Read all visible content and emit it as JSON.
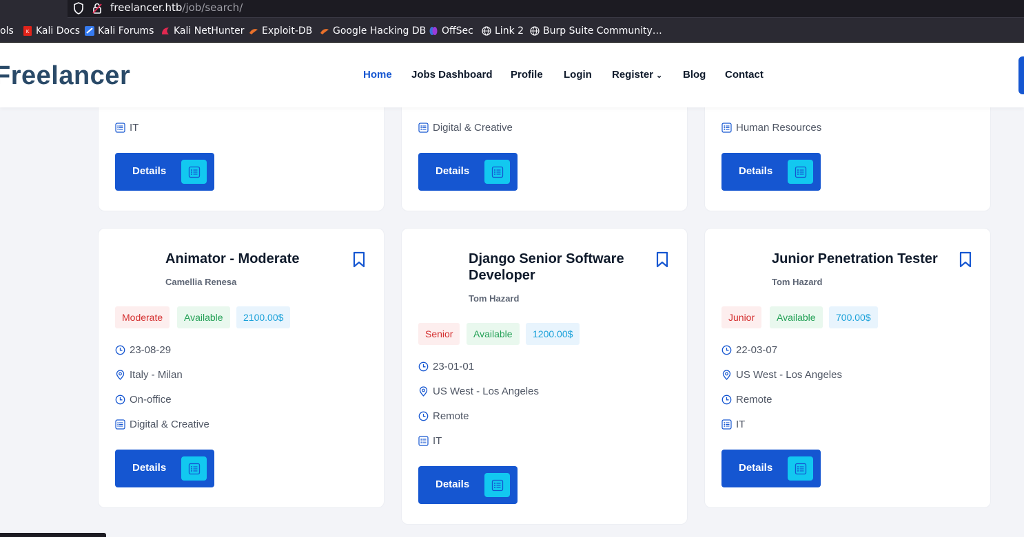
{
  "browser": {
    "url_host": "freelancer.htb",
    "url_path": "/job/search/",
    "bookmarks": [
      {
        "label": "ols",
        "icon": "none"
      },
      {
        "label": "Kali Docs",
        "icon": "kali-docs-icon"
      },
      {
        "label": "Kali Forums",
        "icon": "kali-forums-icon"
      },
      {
        "label": "Kali NetHunter",
        "icon": "kali-nethunter-icon"
      },
      {
        "label": "Exploit-DB",
        "icon": "exploit-db-icon"
      },
      {
        "label": "Google Hacking DB",
        "icon": "ghdb-icon"
      },
      {
        "label": "OffSec",
        "icon": "offsec-icon"
      },
      {
        "label": "Link 2",
        "icon": "globe-icon"
      },
      {
        "label": "Burp Suite Community…",
        "icon": "globe-icon"
      }
    ]
  },
  "site": {
    "logo": "Freelancer",
    "nav": [
      {
        "label": "Home",
        "active": true
      },
      {
        "label": "Jobs Dashboard",
        "active": false
      },
      {
        "label": "Profile",
        "active": false
      },
      {
        "label": "Login",
        "active": false
      },
      {
        "label": "Register",
        "active": false,
        "dropdown": true
      },
      {
        "label": "Blog",
        "active": false
      },
      {
        "label": "Contact",
        "active": false
      }
    ]
  },
  "top_cards": [
    {
      "category": "IT",
      "button": "Details"
    },
    {
      "category": "Digital & Creative",
      "button": "Details"
    },
    {
      "category": "Human Resources",
      "button": "Details"
    }
  ],
  "jobs": [
    {
      "title": "Animator - Moderate",
      "company": "Camellia Renesa",
      "level": "Moderate",
      "status": "Available",
      "salary": "2100.00$",
      "date": "23-08-29",
      "location": "Italy - Milan",
      "work_mode": "On-office",
      "category": "Digital & Creative",
      "button": "Details"
    },
    {
      "title": "Django Senior Software Developer",
      "company": "Tom Hazard",
      "level": "Senior",
      "status": "Available",
      "salary": "1200.00$",
      "date": "23-01-01",
      "location": "US West - Los Angeles",
      "work_mode": "Remote",
      "category": "IT",
      "button": "Details"
    },
    {
      "title": "Junior Penetration Tester",
      "company": "Tom Hazard",
      "level": "Junior",
      "status": "Available",
      "salary": "700.00$",
      "date": "22-03-07",
      "location": "US West - Los Angeles",
      "work_mode": "Remote",
      "category": "IT",
      "button": "Details"
    }
  ],
  "colors": {
    "primary": "#1556d1",
    "accent": "#12c8f0",
    "logo": "#2a4a68",
    "level_text": "#d42e2e",
    "status_text": "#22a055",
    "salary_text": "#1aa1d9"
  }
}
